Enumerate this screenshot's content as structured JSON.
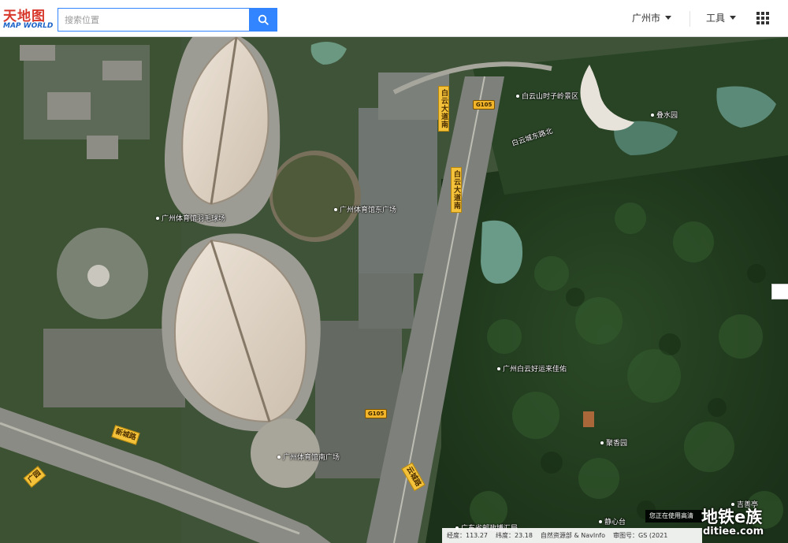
{
  "app": {
    "logo_cn": "天地图",
    "logo_en": "MAP WORLD"
  },
  "search": {
    "placeholder": "搜索位置",
    "value": ""
  },
  "header": {
    "city_label": "广州市",
    "tools_label": "工具"
  },
  "colors": {
    "accent": "#3385ff",
    "road_label_bg": "#f4c23a",
    "forest": "#1f3a1f"
  },
  "icons": [
    "search-icon",
    "grid-apps-icon",
    "chevron-down-icon",
    "poi-marker-icon"
  ],
  "map": {
    "pois": [
      {
        "name": "广州体育馆羽毛球场"
      },
      {
        "name": "广州体育馆东广场"
      },
      {
        "name": "白云山时子岭景区"
      },
      {
        "name": "白云城东路北"
      },
      {
        "name": "叠水园"
      },
      {
        "name": "广州白云好运来佳佑"
      },
      {
        "name": "广州体育馆南广场"
      },
      {
        "name": "聚香园"
      },
      {
        "name": "静心台"
      },
      {
        "name": "吉善亭"
      },
      {
        "name": "广东省邮政博汇局"
      }
    ],
    "roads": [
      {
        "name": "白云大道南"
      },
      {
        "name": "白云大道南"
      },
      {
        "name": "新城路"
      },
      {
        "name": "广园"
      },
      {
        "name": "云城路"
      }
    ],
    "shields": [
      "G105",
      "G105"
    ]
  },
  "footer": {
    "notice": "您正在使用高清",
    "lon_label": "经度：",
    "lon_value": "113.27",
    "lat_label": "纬度：",
    "lat_value": "23.18",
    "copyright": "自然资源部 & NavInfo",
    "approval": "审图号：GS (2021"
  },
  "watermark": {
    "cn": "地铁e族",
    "url": "ditiee.com"
  }
}
